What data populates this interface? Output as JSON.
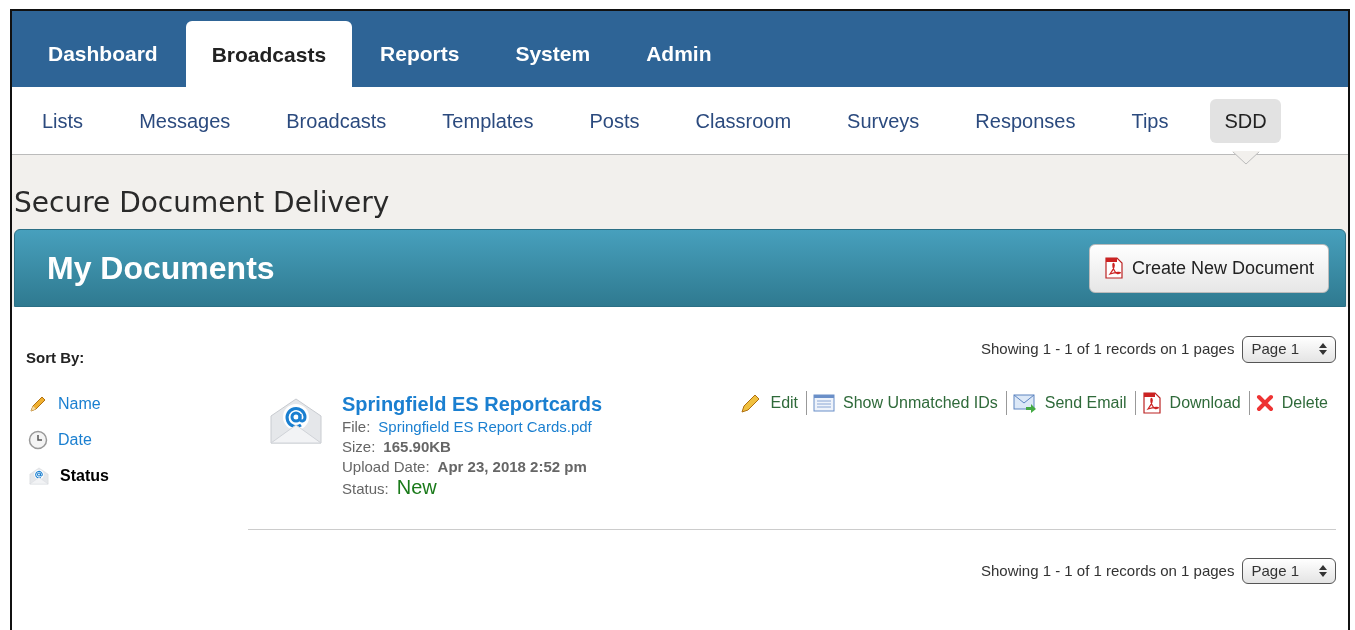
{
  "main_tabs": [
    {
      "label": "Dashboard",
      "selected": false
    },
    {
      "label": "Broadcasts",
      "selected": true
    },
    {
      "label": "Reports",
      "selected": false
    },
    {
      "label": "System",
      "selected": false
    },
    {
      "label": "Admin",
      "selected": false
    }
  ],
  "sub_tabs": [
    {
      "label": "Lists",
      "selected": false
    },
    {
      "label": "Messages",
      "selected": false
    },
    {
      "label": "Broadcasts",
      "selected": false
    },
    {
      "label": "Templates",
      "selected": false
    },
    {
      "label": "Posts",
      "selected": false
    },
    {
      "label": "Classroom",
      "selected": false
    },
    {
      "label": "Surveys",
      "selected": false
    },
    {
      "label": "Responses",
      "selected": false
    },
    {
      "label": "Tips",
      "selected": false
    },
    {
      "label": "SDD",
      "selected": true
    }
  ],
  "page_title": "Secure Document Delivery",
  "panel": {
    "title": "My Documents",
    "create_button": "Create New Document"
  },
  "sort": {
    "label": "Sort By:",
    "items": [
      {
        "kind": "name",
        "label": "Name",
        "selected": false
      },
      {
        "kind": "date",
        "label": "Date",
        "selected": false
      },
      {
        "kind": "status",
        "label": "Status",
        "selected": true
      }
    ]
  },
  "pager_top": {
    "summary": "Showing 1 - 1 of 1 records on 1 pages",
    "page": "Page 1"
  },
  "documents": [
    {
      "title": "Springfield ES Reportcards",
      "file_label": "File:",
      "file": "Springfield ES Report Cards.pdf",
      "size_label": "Size:",
      "size": "165.90KB",
      "date_label": "Upload Date:",
      "date": "Apr 23, 2018 2:52 pm",
      "status_label": "Status:",
      "status": "New",
      "actions": [
        {
          "kind": "edit",
          "label": "Edit"
        },
        {
          "kind": "list",
          "label": "Show Unmatched IDs"
        },
        {
          "kind": "email",
          "label": "Send Email"
        },
        {
          "kind": "pdf",
          "label": "Download"
        },
        {
          "kind": "delete",
          "label": "Delete"
        }
      ]
    }
  ],
  "pager_bottom": {
    "summary": "Showing 1 - 1 of 1 records on 1 pages",
    "page": "Page 1"
  }
}
